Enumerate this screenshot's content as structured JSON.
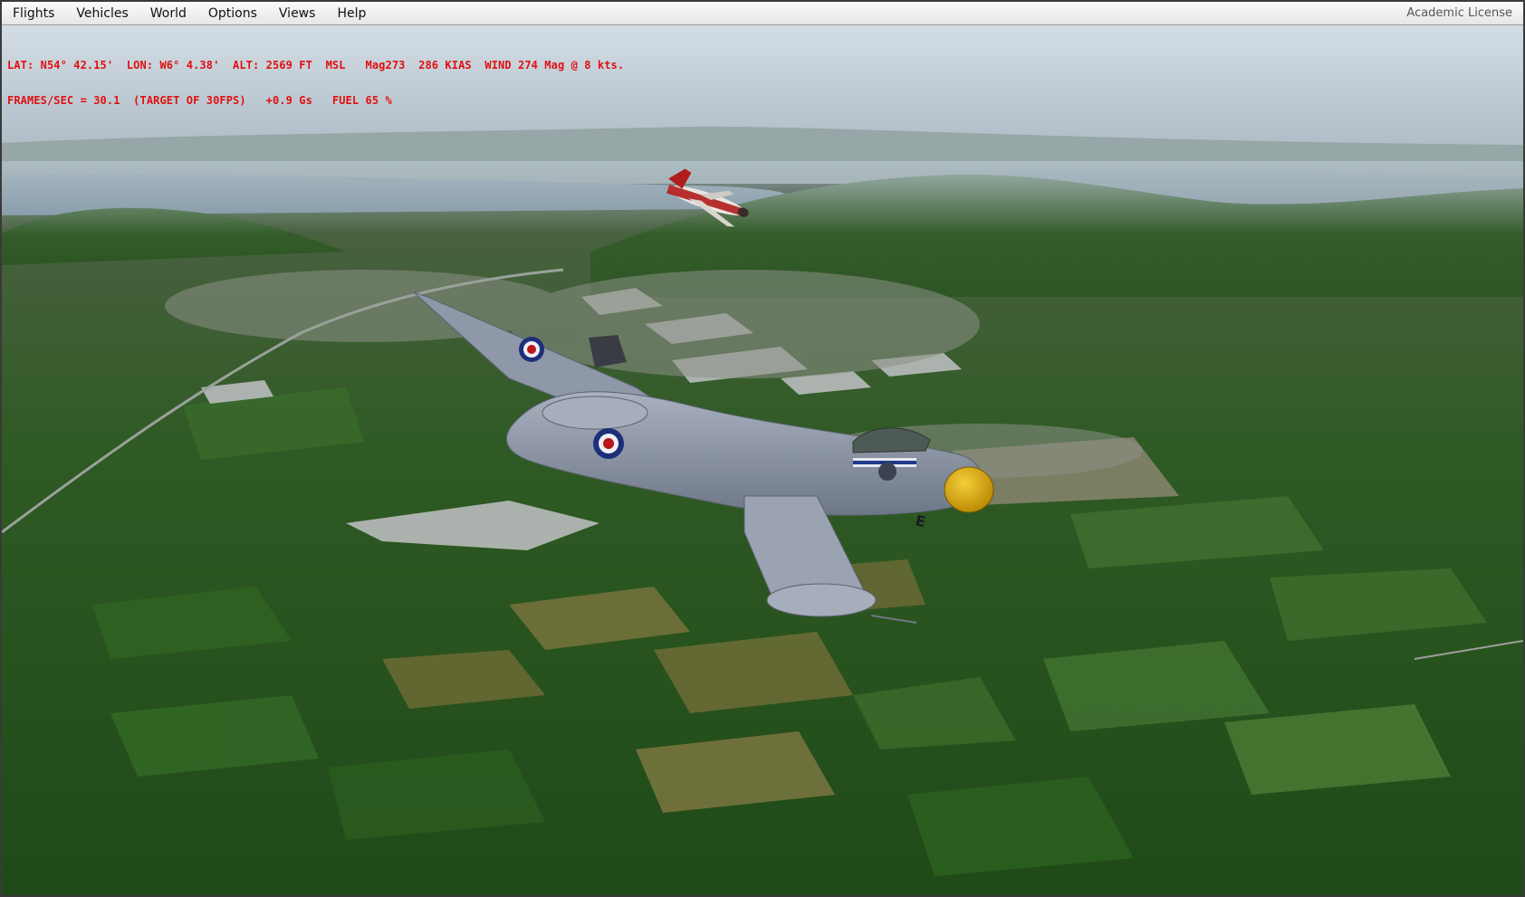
{
  "menu": {
    "items": [
      {
        "label": "Flights"
      },
      {
        "label": "Vehicles"
      },
      {
        "label": "World"
      },
      {
        "label": "Options"
      },
      {
        "label": "Views"
      },
      {
        "label": "Help"
      }
    ],
    "license": "Academic License"
  },
  "hud": {
    "line1": "LAT: N54° 42.15'  LON: W6° 4.38'  ALT: 2569 FT  MSL   Mag273  286 KIAS  WIND 274 Mag @ 8 kts.",
    "line2": "FRAMES/SEC = 30.1  (TARGET OF 30FPS)   +0.9 Gs   FUEL 65 %"
  },
  "aircraft": {
    "fuselage_marking": "E"
  },
  "colors": {
    "hud_text": "#e01010",
    "sky_top": "#c6d3dd",
    "sky_horizon": "#a7b6c0",
    "water": "#7f95a4",
    "aircraft_body": "#8e97a6",
    "nose_cone": "#d8a400",
    "roundel_outer": "#1d2f7a",
    "roundel_inner": "#b81818"
  }
}
